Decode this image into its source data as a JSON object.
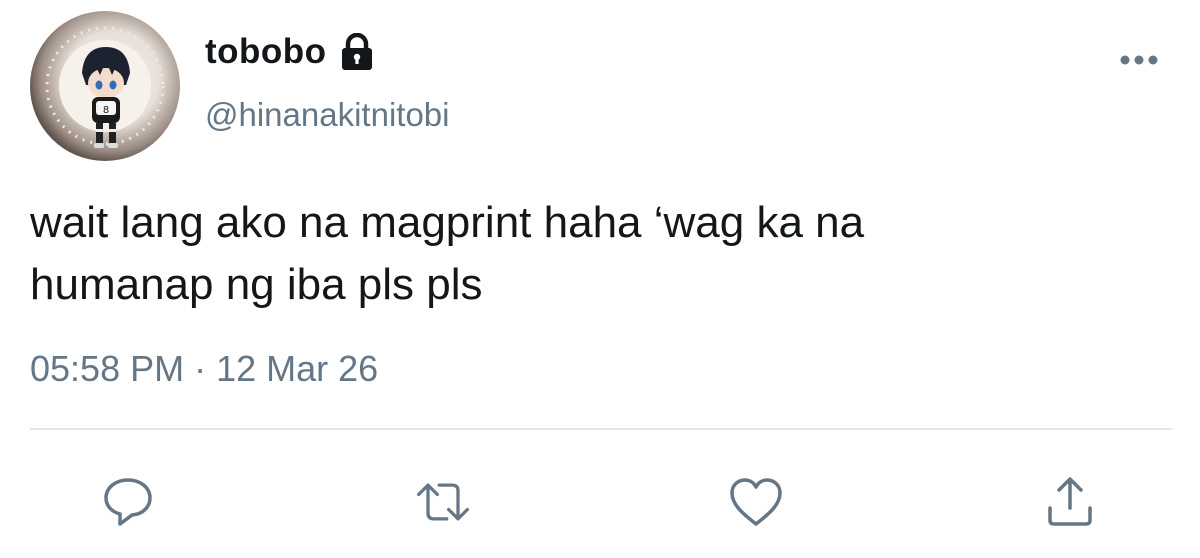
{
  "tweet": {
    "display_name": "tobobo",
    "handle": "@hinanakitnitobi",
    "text_line_1": "wait lang ako na magprint haha ‘wag ka na",
    "text_line_2": "humanap ng iba pls pls",
    "timestamp": "05:58 PM · 12 Mar 26",
    "account_status_icon": "lock-icon",
    "more_icon": "more-dots-icon"
  },
  "actions": [
    {
      "icon": "reply-icon"
    },
    {
      "icon": "retweet-icon"
    },
    {
      "icon": "like-icon"
    },
    {
      "icon": "share-icon"
    }
  ],
  "colors": {
    "text": "#14171a",
    "secondary": "#657786",
    "divider": "#e1e8ed"
  }
}
